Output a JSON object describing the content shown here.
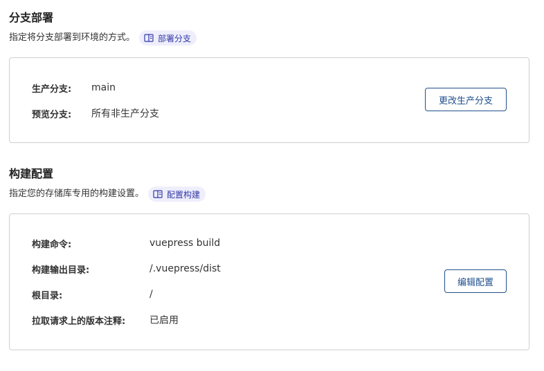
{
  "branch_deploy": {
    "title": "分支部署",
    "description": "指定将分支部署到环境的方式。",
    "doc_link_icon": "book-icon",
    "doc_link_label": "部署分支",
    "rows": [
      {
        "key": "生产分支:",
        "value": "main"
      },
      {
        "key": "预览分支:",
        "value": "所有非生产分支"
      }
    ],
    "action_label": "更改生产分支"
  },
  "build_config": {
    "title": "构建配置",
    "description": "指定您的存储库专用的构建设置。",
    "doc_link_icon": "book-icon",
    "doc_link_label": "配置构建",
    "rows": [
      {
        "key": "构建命令:",
        "value": "vuepress build"
      },
      {
        "key": "构建输出目录:",
        "value": "/.vuepress/dist"
      },
      {
        "key": "根目录:",
        "value": "/"
      },
      {
        "key": "拉取请求上的版本注释:",
        "value": "已启用"
      }
    ],
    "action_label": "编辑配置"
  },
  "colors": {
    "accent": "#1f4f8c",
    "chip_bg": "#eeeefc",
    "chip_text": "#3338a6",
    "card_border": "#cfcfcf"
  }
}
